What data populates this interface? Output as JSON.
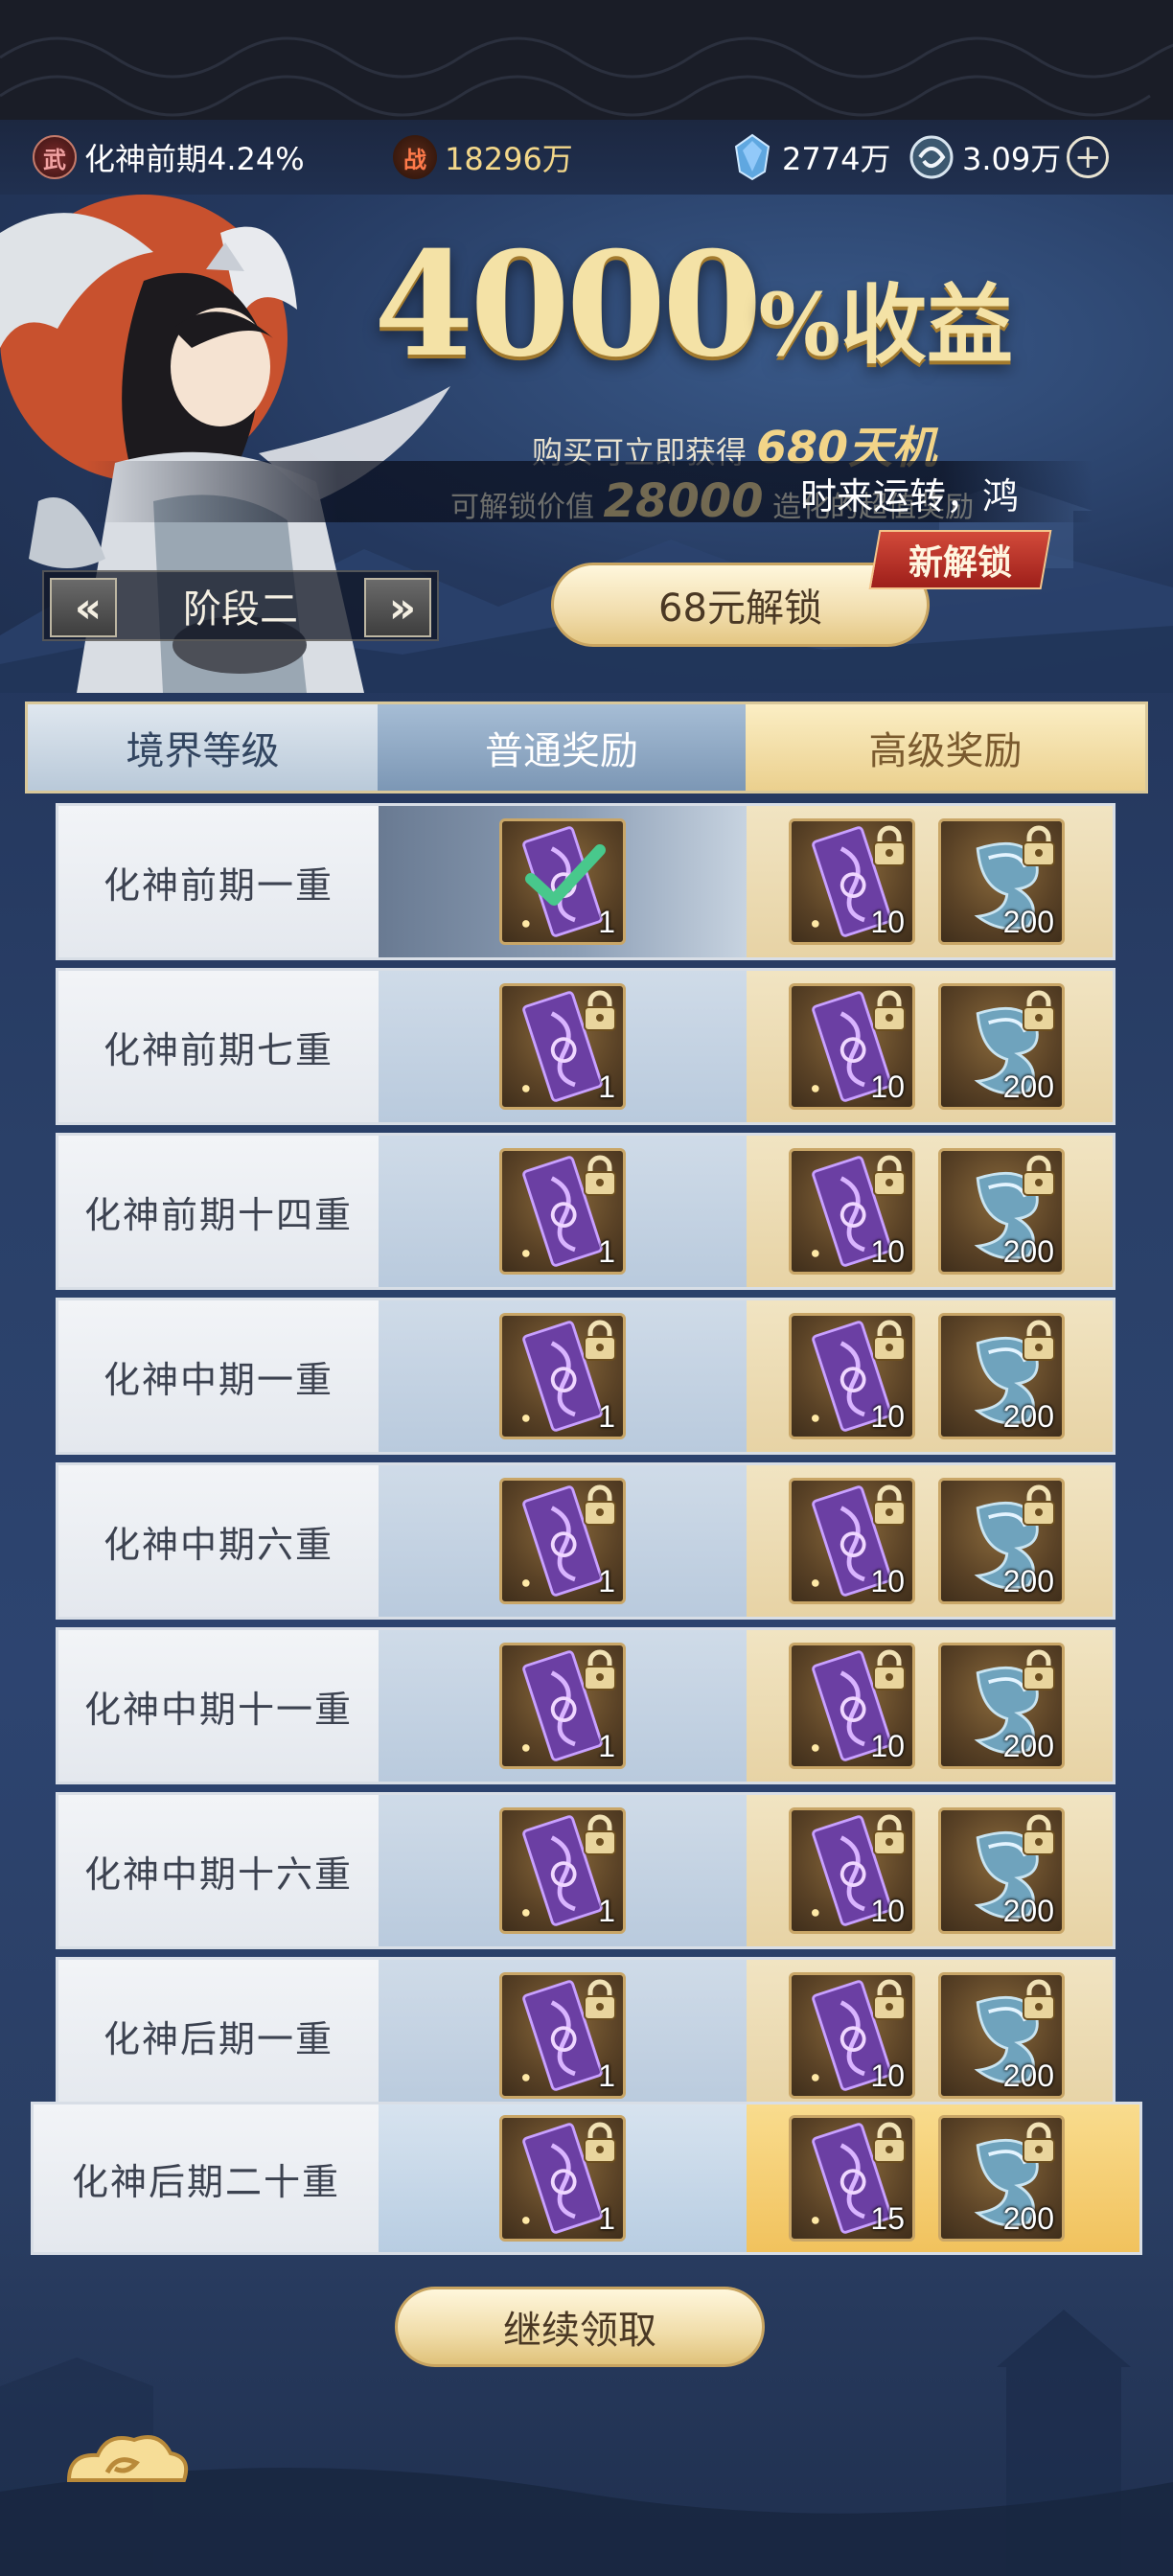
{
  "resources": {
    "realm_badge": "武",
    "realm": "化神前期4.24%",
    "power_badge": "战",
    "power": "18296万",
    "currency1": "2774万",
    "currency2": "3.09万",
    "currency1_icon": "blue-crystal-icon",
    "currency2_icon": "spirit-coin-icon"
  },
  "hero": {
    "title_main": "4000",
    "title_pct": "%",
    "title_tail": "收益",
    "buy_text": "购买可立即获得",
    "buy_amount": "680天机",
    "unlock_value_prefix": "可解锁价值",
    "unlock_value_amount": "28000",
    "unlock_value_suffix": "造化的超值奖励",
    "marquee": "时来运转，鸿"
  },
  "stage": {
    "prev": "«",
    "label": "阶段二",
    "next": "»"
  },
  "unlock": {
    "button": "68元解锁",
    "badge": "新解锁"
  },
  "table": {
    "headers": [
      "境界等级",
      "普通奖励",
      "高级奖励"
    ],
    "rows": [
      {
        "level": "化神前期一重",
        "normal": "1",
        "premium1": "10",
        "premium2": "200",
        "claimed": true
      },
      {
        "level": "化神前期七重",
        "normal": "1",
        "premium1": "10",
        "premium2": "200",
        "claimed": false
      },
      {
        "level": "化神前期十四重",
        "normal": "1",
        "premium1": "10",
        "premium2": "200",
        "claimed": false
      },
      {
        "level": "化神中期一重",
        "normal": "1",
        "premium1": "10",
        "premium2": "200",
        "claimed": false
      },
      {
        "level": "化神中期六重",
        "normal": "1",
        "premium1": "10",
        "premium2": "200",
        "claimed": false
      },
      {
        "level": "化神中期十一重",
        "normal": "1",
        "premium1": "10",
        "premium2": "200",
        "claimed": false
      },
      {
        "level": "化神中期十六重",
        "normal": "1",
        "premium1": "10",
        "premium2": "200",
        "claimed": false
      },
      {
        "level": "化神后期一重",
        "normal": "1",
        "premium1": "10",
        "premium2": "200",
        "claimed": false
      },
      {
        "level": "化神后期二十重",
        "normal": "1",
        "premium1": "15",
        "premium2": "200",
        "claimed": false
      }
    ],
    "item_icons": {
      "normal": "purple-talisman-icon",
      "premium2": "jade-hook-icon"
    }
  },
  "footer": {
    "continue": "继续领取",
    "cloud_icon": "auspicious-cloud-icon"
  },
  "colors": {
    "gold": "#f4e2a6",
    "premium_bg": "#e7d3a5",
    "normal_bg": "#b9cadd",
    "badge_red": "#b2281f"
  }
}
